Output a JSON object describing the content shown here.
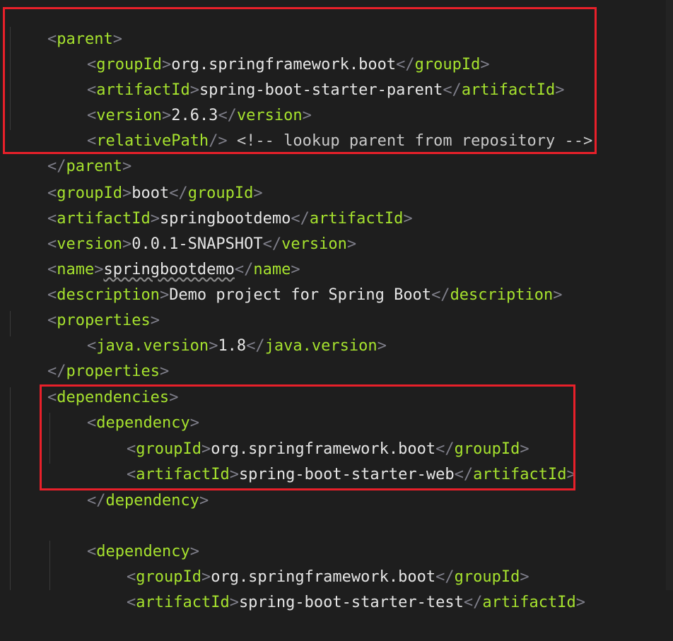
{
  "colors": {
    "background": "#1e1e1e",
    "tag": "#a6e22e",
    "bracket": "#7f7f8a",
    "highlight_box": "#e8202a"
  },
  "lines": [
    {
      "tag": "parent",
      "kind": "open"
    },
    {
      "tag": "groupId",
      "value": "org.springframework.boot"
    },
    {
      "tag": "artifactId",
      "value": "spring-boot-starter-parent"
    },
    {
      "tag": "version",
      "value": "2.6.3"
    },
    {
      "tag": "relativePath",
      "kind": "selfclose",
      "comment": "<!-- lookup parent from repository -->"
    },
    {
      "tag": "parent",
      "kind": "close"
    },
    {
      "tag": "groupId",
      "value": "boot"
    },
    {
      "tag": "artifactId",
      "value": "springbootdemo"
    },
    {
      "tag": "version",
      "value": "0.0.1-SNAPSHOT"
    },
    {
      "tag": "name",
      "value": "springbootdemo"
    },
    {
      "tag": "description",
      "value": "Demo project for Spring Boot"
    },
    {
      "tag": "properties",
      "kind": "open"
    },
    {
      "tag": "java.version",
      "value": "1.8"
    },
    {
      "tag": "properties",
      "kind": "close"
    },
    {
      "tag": "dependencies",
      "kind": "open"
    },
    {
      "tag": "dependency",
      "kind": "open"
    },
    {
      "tag": "groupId",
      "value": "org.springframework.boot"
    },
    {
      "tag": "artifactId",
      "value": "spring-boot-starter-web"
    },
    {
      "tag": "dependency",
      "kind": "close"
    },
    {
      "tag": "dependency",
      "kind": "open"
    },
    {
      "tag": "groupId",
      "value": "org.springframework.boot"
    },
    {
      "tag": "artifactId",
      "value": "spring-boot-starter-test"
    }
  ]
}
